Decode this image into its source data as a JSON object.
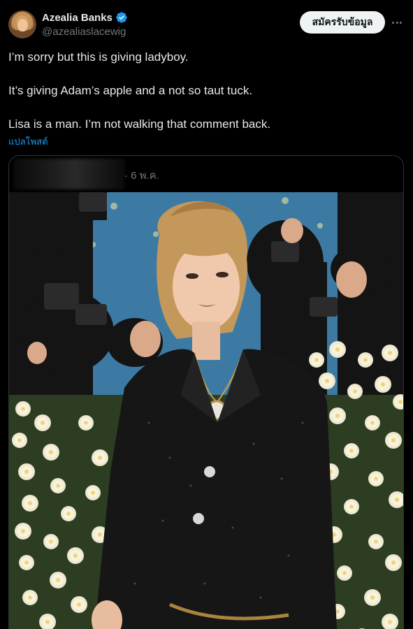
{
  "author": {
    "display_name": "Azealia Banks",
    "handle": "@azealiaslacewig",
    "verified": true
  },
  "actions": {
    "subscribe_label": "สมัครรับข้อมูล"
  },
  "tweet": {
    "paragraphs": [
      "I’m sorry but this is giving ladyboy.",
      "It’s giving Adam’s apple and a not so taut tuck.",
      "Lisa is a man. I’m not walking that comment back."
    ],
    "translate_label": "แปลโพสต์"
  },
  "quoted_post": {
    "date": "· 6 พ.ค."
  },
  "colors": {
    "background": "#000000",
    "text": "#e7e9ea",
    "muted": "#71767b",
    "link": "#1d9bf0",
    "border": "#2f3336",
    "button_bg": "#eff3f4"
  },
  "icons": {
    "verified": "verified-badge-icon",
    "more": "more-options-icon"
  }
}
